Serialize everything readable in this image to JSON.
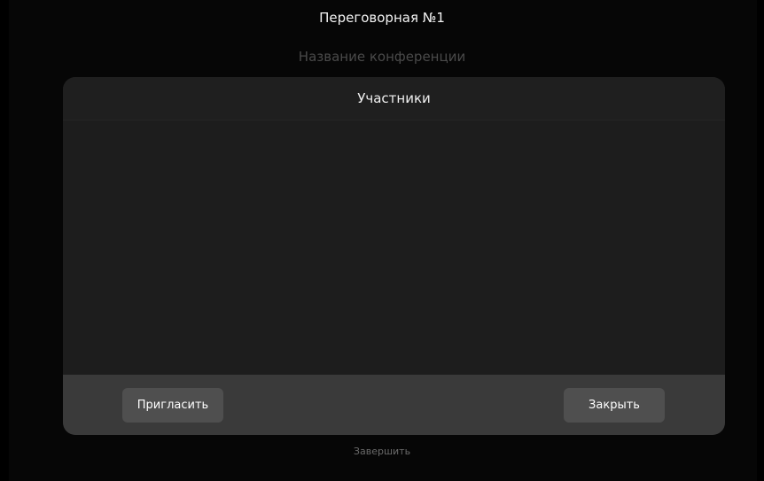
{
  "header": {
    "room_title": "Переговорная №1",
    "conference_name_placeholder": "Название конференции"
  },
  "dialog": {
    "title": "Участники",
    "participants": [],
    "invite_label": "Пригласить",
    "close_label": "Закрыть"
  },
  "footer": {
    "end_label": "Завершить"
  }
}
